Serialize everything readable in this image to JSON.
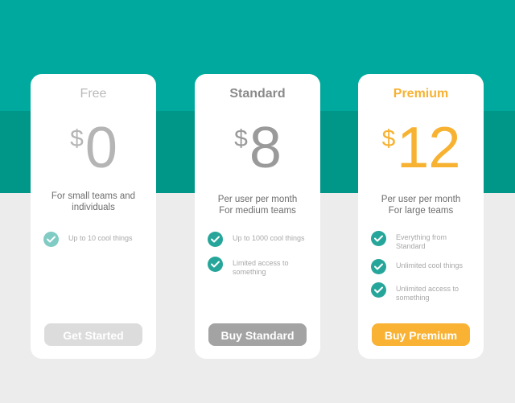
{
  "colors": {
    "header_teal": "#00a99d",
    "band_teal": "#009688",
    "page_background": "#ececec",
    "card_background": "#ffffff",
    "check_teal": "#26a69a",
    "premium_accent": "#f7b232",
    "standard_button": "#a3a3a3",
    "free_button": "#dcdcdc"
  },
  "plans": [
    {
      "name": "Free",
      "currency": "$",
      "price": "0",
      "description": [
        "For small teams and",
        "individuals"
      ],
      "features": [
        {
          "icon": "check-circle-icon",
          "text": "Up to 10 cool things"
        }
      ],
      "cta_label": "Get Started"
    },
    {
      "name": "Standard",
      "currency": "$",
      "price": "8",
      "description": [
        "Per user per month",
        "For medium teams"
      ],
      "features": [
        {
          "icon": "check-circle-icon",
          "text": "Up to 1000 cool things"
        },
        {
          "icon": "check-circle-icon",
          "text": "Limited access to something"
        }
      ],
      "cta_label": "Buy Standard"
    },
    {
      "name": "Premium",
      "currency": "$",
      "price": "12",
      "description": [
        "Per user per month",
        "For large teams"
      ],
      "features": [
        {
          "icon": "check-circle-icon",
          "text": "Everything from Standard"
        },
        {
          "icon": "check-circle-icon",
          "text": "Unlimited cool things"
        },
        {
          "icon": "check-circle-icon",
          "text": "Unlimited access to something"
        }
      ],
      "cta_label": "Buy Premium"
    }
  ]
}
